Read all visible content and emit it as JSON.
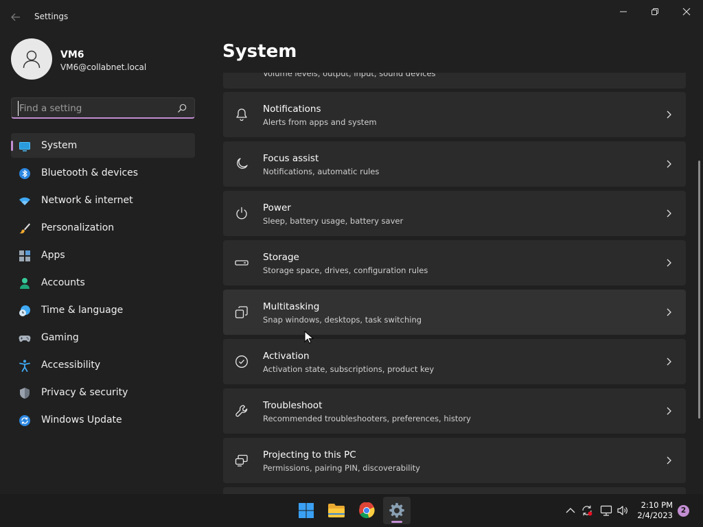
{
  "window": {
    "app_title": "Settings"
  },
  "profile": {
    "name": "VM6",
    "email": "VM6@collabnet.local"
  },
  "search": {
    "placeholder": "Find a setting",
    "value": ""
  },
  "sidebar": {
    "items": [
      {
        "label": "System",
        "icon": "system-icon",
        "active": true
      },
      {
        "label": "Bluetooth & devices",
        "icon": "bluetooth-icon"
      },
      {
        "label": "Network & internet",
        "icon": "wifi-icon"
      },
      {
        "label": "Personalization",
        "icon": "brush-icon"
      },
      {
        "label": "Apps",
        "icon": "apps-icon"
      },
      {
        "label": "Accounts",
        "icon": "accounts-icon"
      },
      {
        "label": "Time & language",
        "icon": "time-language-icon"
      },
      {
        "label": "Gaming",
        "icon": "gamepad-icon"
      },
      {
        "label": "Accessibility",
        "icon": "accessibility-icon"
      },
      {
        "label": "Privacy & security",
        "icon": "shield-icon"
      },
      {
        "label": "Windows Update",
        "icon": "update-icon"
      }
    ]
  },
  "main": {
    "title": "System",
    "partial_top_subtitle": "Volume levels, output, input, sound devices",
    "cards": [
      {
        "title": "Notifications",
        "subtitle": "Alerts from apps and system",
        "icon": "bell-icon"
      },
      {
        "title": "Focus assist",
        "subtitle": "Notifications, automatic rules",
        "icon": "moon-icon"
      },
      {
        "title": "Power",
        "subtitle": "Sleep, battery usage, battery saver",
        "icon": "power-icon"
      },
      {
        "title": "Storage",
        "subtitle": "Storage space, drives, configuration rules",
        "icon": "storage-icon"
      },
      {
        "title": "Multitasking",
        "subtitle": "Snap windows, desktops, task switching",
        "icon": "multitasking-icon"
      },
      {
        "title": "Activation",
        "subtitle": "Activation state, subscriptions, product key",
        "icon": "check-circle-icon"
      },
      {
        "title": "Troubleshoot",
        "subtitle": "Recommended troubleshooters, preferences, history",
        "icon": "wrench-icon"
      },
      {
        "title": "Projecting to this PC",
        "subtitle": "Permissions, pairing PIN, discoverability",
        "icon": "projecting-icon"
      }
    ]
  },
  "taskbar": {
    "apps": [
      "windows-start-icon",
      "file-explorer-icon",
      "chrome-icon",
      "settings-gear-icon"
    ],
    "clock": {
      "time": "2:10 PM",
      "date": "2/4/2023"
    },
    "notification_count": "2"
  },
  "colors": {
    "accent": "#c38ed3",
    "background": "#202020",
    "card": "#2b2b2b",
    "taskbar": "#1c1c1c"
  }
}
